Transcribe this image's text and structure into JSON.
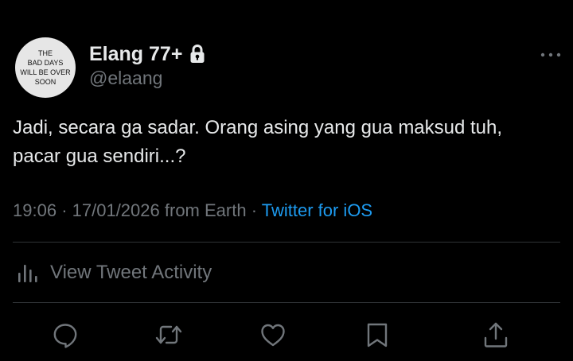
{
  "avatar": {
    "lines": [
      "THE",
      "BAD DAYS",
      "WILL BE OVER",
      "SOON"
    ]
  },
  "user": {
    "display_name": "Elang 77+",
    "handle": "@elaang",
    "protected_icon": "lock-icon"
  },
  "tweet": {
    "lines": [
      "Jadi, secara ga sadar. Orang asing yang gua maksud tuh,",
      "pacar gua sendiri...?"
    ]
  },
  "meta": {
    "time": "19:06",
    "date": "17/01/2026",
    "location": "from Earth",
    "separator": "·",
    "source": "Twitter for iOS"
  },
  "activity": {
    "label": "View Tweet Activity",
    "icon": "analytics-icon"
  },
  "actions": [
    {
      "name": "reply",
      "icon": "reply-icon"
    },
    {
      "name": "retweet",
      "icon": "retweet-icon"
    },
    {
      "name": "like",
      "icon": "heart-icon"
    },
    {
      "name": "bookmark",
      "icon": "bookmark-icon"
    },
    {
      "name": "share",
      "icon": "share-icon"
    }
  ],
  "colors": {
    "background": "#000000",
    "text_primary": "#e7e9ea",
    "text_secondary": "#71767b",
    "link": "#1d9bf0",
    "divider": "#2f3336",
    "avatar_bg": "#e6e6e6"
  }
}
